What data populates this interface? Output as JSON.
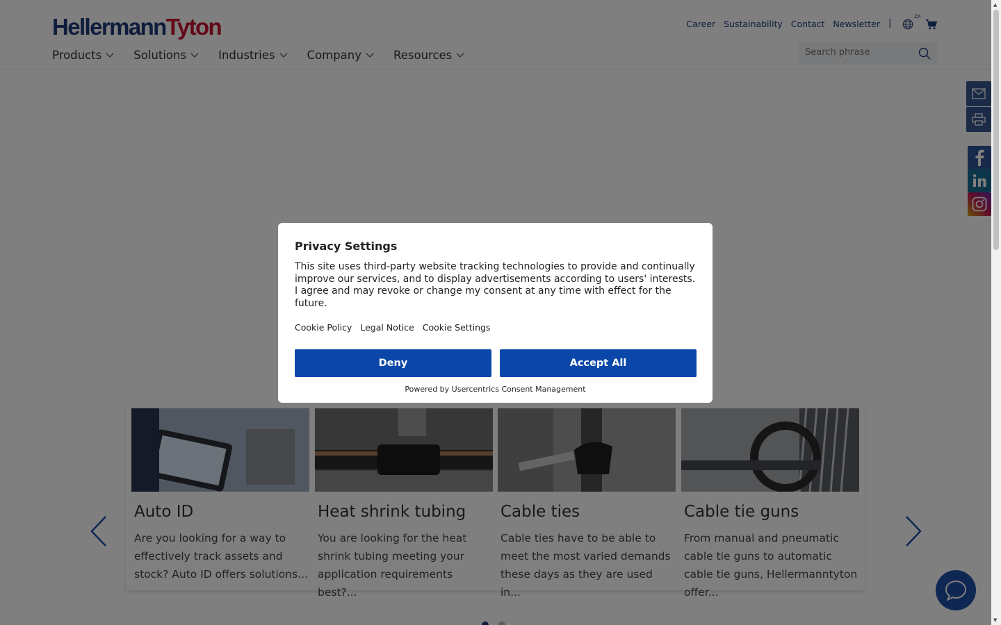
{
  "brand": {
    "part1": "Hellermann",
    "part2": "Tyton"
  },
  "top_links": [
    "Career",
    "Sustainability",
    "Contact",
    "Newsletter"
  ],
  "separator": "|",
  "region_badge": "ZA",
  "nav": [
    "Products",
    "Solutions",
    "Industries",
    "Company",
    "Resources"
  ],
  "search": {
    "placeholder": "Search phrase"
  },
  "cards": [
    {
      "title": "Auto ID",
      "desc": "Are you looking for a way to effectively track assets and stock? Auto ID offers solutions..."
    },
    {
      "title": "Heat shrink tubing",
      "desc": "You are looking for the heat shrink tubing meeting your application requirements best?..."
    },
    {
      "title": "Cable ties",
      "desc": "Cable ties have to be able to meet the most varied demands these days as they are used in..."
    },
    {
      "title": "Cable tie guns",
      "desc": "From manual and pneumatic cable tie guns to automatic cable tie guns, Hellermanntyton offer..."
    }
  ],
  "modal": {
    "title": "Privacy Settings",
    "body": "This site uses third-party website tracking technologies to provide and continually improve our services, and to display advertisements according to users' interests. I agree and may revoke or change my consent at any time with effect for the future.",
    "links": [
      "Cookie Policy",
      "Legal Notice",
      "Cookie Settings"
    ],
    "deny": "Deny",
    "accept": "Accept All",
    "powered": "Powered by Usercentrics Consent Management"
  },
  "colors": {
    "brand_blue": "#1f3a7a",
    "brand_red": "#c8102e",
    "button_blue": "#0a47a9"
  }
}
